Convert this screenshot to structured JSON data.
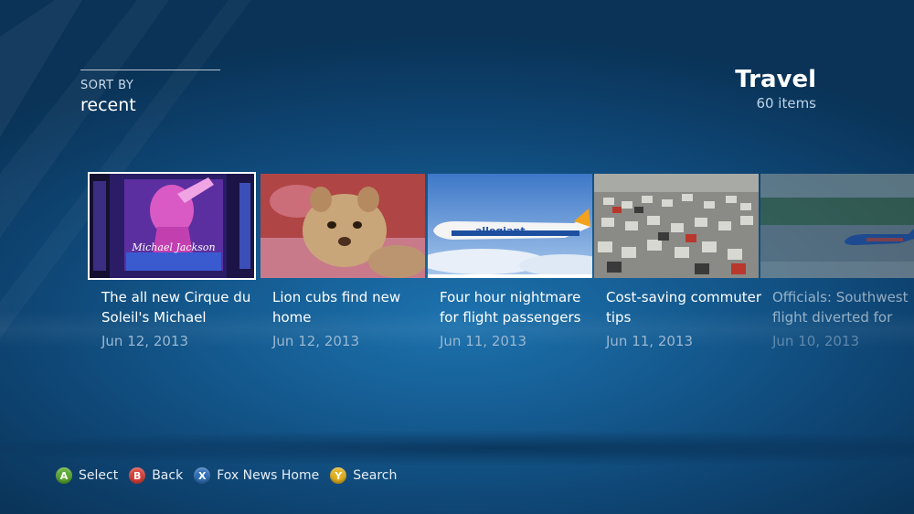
{
  "sort": {
    "caption": "SORT BY",
    "value": "recent"
  },
  "heading": {
    "title": "Travel",
    "count": "60 items"
  },
  "tiles": [
    {
      "title": "The all new Cirque du Soleil's Michael",
      "date": "Jun 12, 2013"
    },
    {
      "title": "Lion cubs find new home",
      "date": "Jun 12, 2013"
    },
    {
      "title": "Four hour nightmare for flight passengers",
      "date": "Jun 11, 2013"
    },
    {
      "title": "Cost-saving commuter tips",
      "date": "Jun 11, 2013"
    },
    {
      "title": "Officials: Southwest flight diverted for",
      "date": "Jun 10, 2013"
    }
  ],
  "thumb_text": {
    "airline": "allegiant",
    "signature": "Michael Jackson"
  },
  "legend": [
    {
      "key": "A",
      "label": "Select",
      "color": "#5aa832"
    },
    {
      "key": "B",
      "label": "Back",
      "color": "#d8403a"
    },
    {
      "key": "X",
      "label": "Fox News Home",
      "color": "#2f6fb7"
    },
    {
      "key": "Y",
      "label": "Search",
      "color": "#e1b020"
    }
  ]
}
